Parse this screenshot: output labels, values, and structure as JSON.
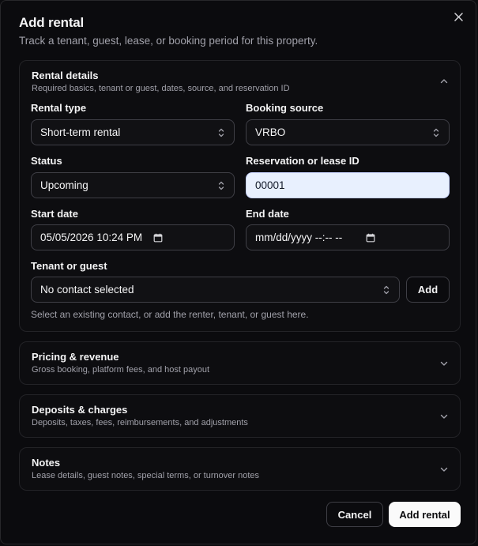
{
  "dialog": {
    "title": "Add rental",
    "subtitle": "Track a tenant, guest, lease, or booking period for this property."
  },
  "sections": {
    "rental_details": {
      "title": "Rental details",
      "desc": "Required basics, tenant or guest, dates, source, and reservation ID",
      "expanded": true
    },
    "pricing": {
      "title": "Pricing & revenue",
      "desc": "Gross booking, platform fees, and host payout",
      "expanded": false
    },
    "deposits": {
      "title": "Deposits & charges",
      "desc": "Deposits, taxes, fees, reimbursements, and adjustments",
      "expanded": false
    },
    "notes": {
      "title": "Notes",
      "desc": "Lease details, guest notes, special terms, or turnover notes",
      "expanded": false
    }
  },
  "form": {
    "rental_type": {
      "label": "Rental type",
      "value": "Short-term rental"
    },
    "booking_source": {
      "label": "Booking source",
      "value": "VRBO"
    },
    "status": {
      "label": "Status",
      "value": "Upcoming"
    },
    "reservation_id": {
      "label": "Reservation or lease ID",
      "value": "00001"
    },
    "start_date": {
      "label": "Start date",
      "value": "05/05/2026 10:24 PM"
    },
    "end_date": {
      "label": "End date",
      "value": "mm/dd/yyyy --:-- --"
    },
    "tenant": {
      "label": "Tenant or guest",
      "value": "No contact selected",
      "add_label": "Add",
      "hint": "Select an existing contact, or add the renter, tenant, or guest here."
    }
  },
  "footer": {
    "cancel_label": "Cancel",
    "submit_label": "Add rental"
  },
  "icons": {
    "close": "close-icon",
    "select": "chevron-up-down-icon",
    "calendar": "calendar-icon",
    "collapse": "chevron-up-icon",
    "expand": "chevron-down-icon"
  }
}
